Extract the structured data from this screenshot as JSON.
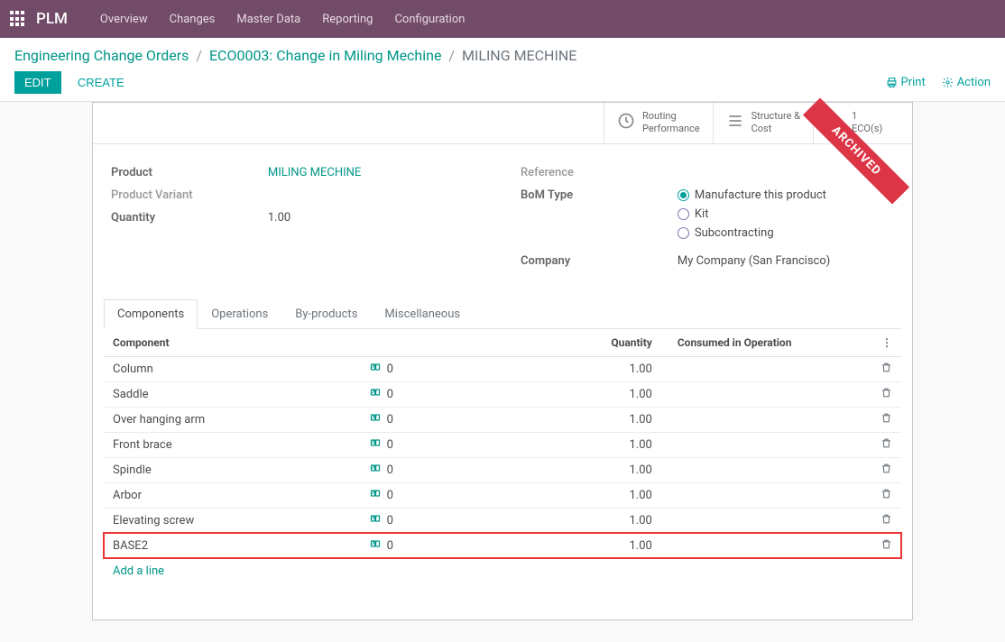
{
  "brand": "PLM",
  "nav": [
    "Overview",
    "Changes",
    "Master Data",
    "Reporting",
    "Configuration"
  ],
  "breadcrumb": {
    "a": "Engineering Change Orders",
    "b": "ECO0003: Change in Miling Mechine",
    "c": "MILING MECHINE"
  },
  "buttons": {
    "edit": "EDIT",
    "create": "CREATE",
    "print": "Print",
    "action": "Action"
  },
  "stats": {
    "routing1": "Routing",
    "routing2": "Performance",
    "struct1": "Structure &",
    "struct2": "Cost",
    "eco_n": "1",
    "eco_l": "ECO(s)"
  },
  "ribbon": "ARCHIVED",
  "left": {
    "product_l": "Product",
    "product_v": "MILING MECHINE",
    "variant_l": "Product Variant",
    "qty_l": "Quantity",
    "qty_v": "1.00"
  },
  "right": {
    "ref_l": "Reference",
    "bom_l": "BoM Type",
    "bom_opts": [
      "Manufacture this product",
      "Kit",
      "Subcontracting"
    ],
    "company_l": "Company",
    "company_v": "My Company (San Francisco)"
  },
  "tabs": [
    "Components",
    "Operations",
    "By-products",
    "Miscellaneous"
  ],
  "thead": {
    "c1": "Component",
    "c2": "Quantity",
    "c3": "Consumed in Operation"
  },
  "rows": [
    {
      "name": "Column",
      "ref": "0",
      "qty": "1.00"
    },
    {
      "name": "Saddle",
      "ref": "0",
      "qty": "1.00"
    },
    {
      "name": "Over hanging arm",
      "ref": "0",
      "qty": "1.00"
    },
    {
      "name": "Front brace",
      "ref": "0",
      "qty": "1.00"
    },
    {
      "name": "Spindle",
      "ref": "0",
      "qty": "1.00"
    },
    {
      "name": "Arbor",
      "ref": "0",
      "qty": "1.00"
    },
    {
      "name": "Elevating screw",
      "ref": "0",
      "qty": "1.00"
    },
    {
      "name": "BASE2",
      "ref": "0",
      "qty": "1.00",
      "hl": true
    }
  ],
  "add_line": "Add a line"
}
